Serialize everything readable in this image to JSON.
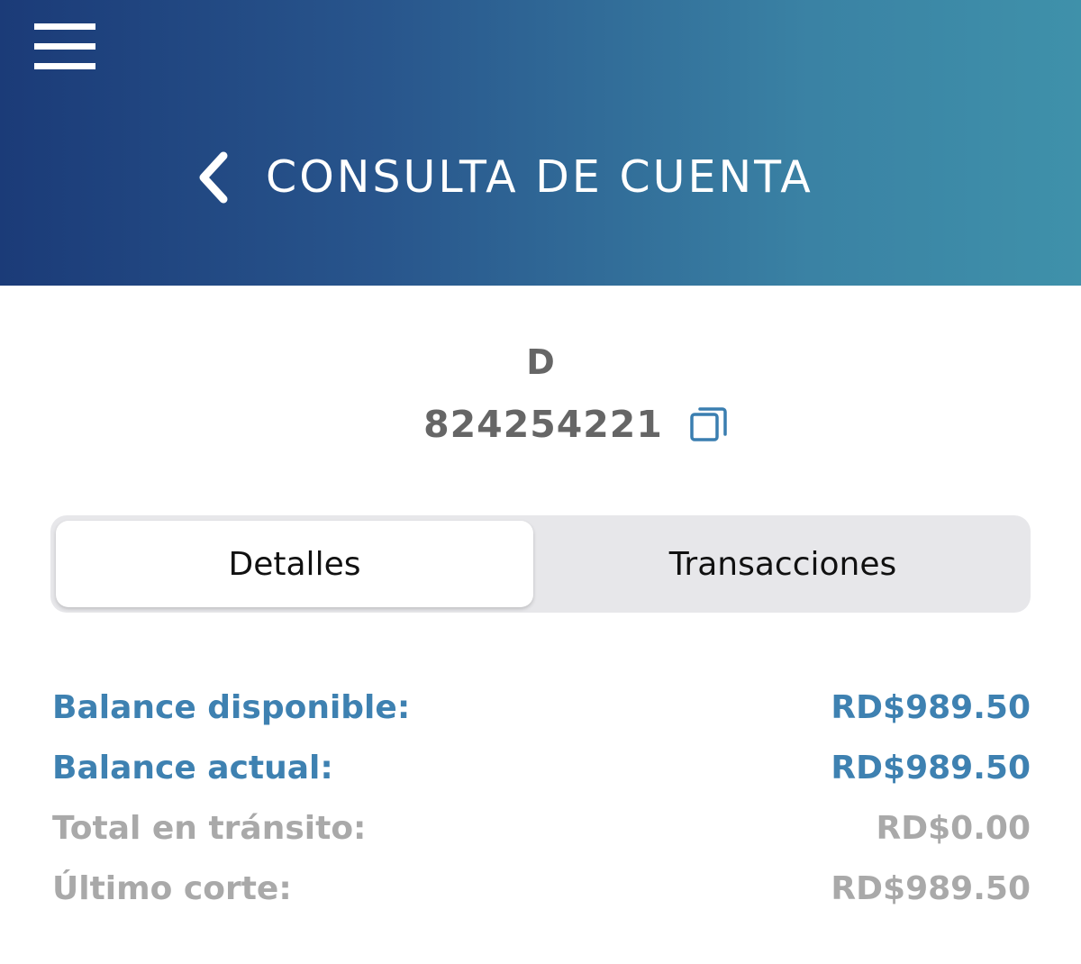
{
  "header": {
    "title": "CONSULTA DE CUENTA",
    "menu_icon": "hamburger-menu-icon",
    "back_icon": "chevron-left-icon",
    "gradient_start": "#1b3b78",
    "gradient_end": "#3f91aa"
  },
  "account": {
    "name": "D",
    "number": "824254221",
    "copy_icon": "copy-icon"
  },
  "tabs": {
    "items": [
      {
        "label": "Detalles",
        "selected": true
      },
      {
        "label": "Transacciones",
        "selected": false
      }
    ]
  },
  "details": {
    "rows": [
      {
        "label": "Balance disponible:",
        "value": "RD$989.50",
        "style": "primary"
      },
      {
        "label": "Balance actual:",
        "value": "RD$989.50",
        "style": "primary"
      },
      {
        "label": "Total en tránsito:",
        "value": "RD$0.00",
        "style": "secondary"
      },
      {
        "label": "Último corte:",
        "value": "RD$989.50",
        "style": "secondary"
      }
    ]
  },
  "colors": {
    "accent": "#3e81b1",
    "muted": "#a9a9a9",
    "account_text": "#666666"
  }
}
